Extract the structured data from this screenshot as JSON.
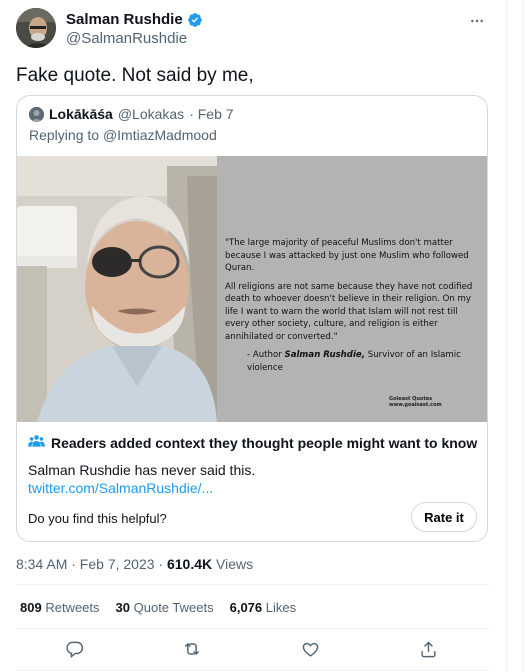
{
  "author": {
    "name": "Salman Rushdie",
    "handle": "@SalmanRushdie",
    "verified": true
  },
  "tweet_text": "Fake quote. Not said by me,",
  "quoted": {
    "name": "Lokākāśa",
    "handle": "@Lokakas",
    "date": "· Feb 7",
    "replying_label": "Replying to",
    "replying_to": "@ImtiazMadmood",
    "image_quote": {
      "para1": "\"The large majority of peaceful Muslims don't matter because I was attacked by just one Muslim who followed Quran.",
      "para2": "All religions are not same because they have not codified death to whoever doesn't believe in their religion. On my life I want to warn the world that Islam will not rest till every other society, culture, and religion is either annihilated or converted.\"",
      "sig_prefix": "- Author",
      "sig_name": "Salman Rushdie,",
      "sig_suffix": "Survivor of an Islamic violence",
      "watermark_line1": "Goleast Quotes",
      "watermark_line2": "www.goalsast.com"
    }
  },
  "context": {
    "title": "Readers added context they thought people might want to know",
    "text": "Salman Rushdie has never said this.",
    "link": "twitter.com/SalmanRushdie/...",
    "helpful_prompt": "Do you find this helpful?",
    "rate_button": "Rate it"
  },
  "meta": {
    "time": "8:34 AM · Feb 7, 2023 ·",
    "views_count": "610.4K",
    "views_label": "Views"
  },
  "stats": {
    "retweets_count": "809",
    "retweets_label": "Retweets",
    "quotes_count": "30",
    "quotes_label": "Quote Tweets",
    "likes_count": "6,076",
    "likes_label": "Likes"
  },
  "icons": {
    "verified": "verified-badge-icon",
    "more": "more-horizontal-icon",
    "community": "community-notes-icon",
    "reply": "reply-icon",
    "retweet": "retweet-icon",
    "like": "like-icon",
    "share": "share-icon"
  },
  "colors": {
    "accent": "#1d9bf0",
    "text_primary": "#0f1419",
    "text_secondary": "#536471",
    "border": "#cfd9de"
  }
}
